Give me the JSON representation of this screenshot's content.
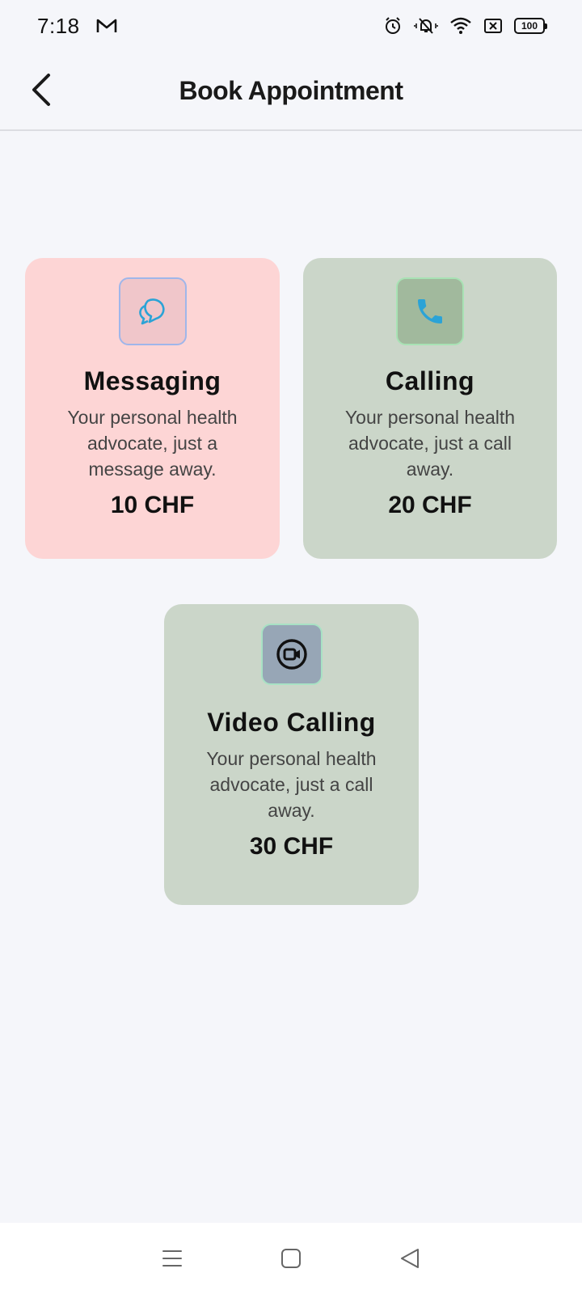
{
  "status_bar": {
    "time": "7:18",
    "battery": "100",
    "icons": [
      "gmail-icon",
      "alarm-icon",
      "vibrate-off-icon",
      "wifi-icon",
      "no-sim-icon",
      "battery-icon"
    ]
  },
  "header": {
    "title": "Book Appointment",
    "back_icon": "chevron-left-icon"
  },
  "options": [
    {
      "id": "messaging",
      "icon": "chat-bubbles-icon",
      "title": "Messaging",
      "description": "Your personal health advocate, just a message away.",
      "price": "10 CHF",
      "colors": {
        "card_bg": "#fdd5d5",
        "icon_bg": "#f0c6ca",
        "icon_border": "#9fb6ea",
        "icon_color": "#2ba3d6"
      }
    },
    {
      "id": "calling",
      "icon": "phone-icon",
      "title": "Calling",
      "description": "Your personal health advocate, just a call away.",
      "price": "20 CHF",
      "colors": {
        "card_bg": "#cbd6c9",
        "icon_bg": "#a1b99d",
        "icon_border": "#a8e2b4",
        "icon_color": "#2ba3d6"
      }
    },
    {
      "id": "video",
      "icon": "video-camera-icon",
      "title": "Video Calling",
      "description": "Your personal health advocate, just a call away.",
      "price": "30 CHF",
      "colors": {
        "card_bg": "#cbd6c9",
        "icon_bg": "#97a6b6",
        "icon_border": "#a8e2c4",
        "icon_color": "#111111"
      }
    }
  ],
  "nav_bar": {
    "icons": [
      "menu-icon",
      "home-square-icon",
      "back-triangle-icon"
    ]
  }
}
